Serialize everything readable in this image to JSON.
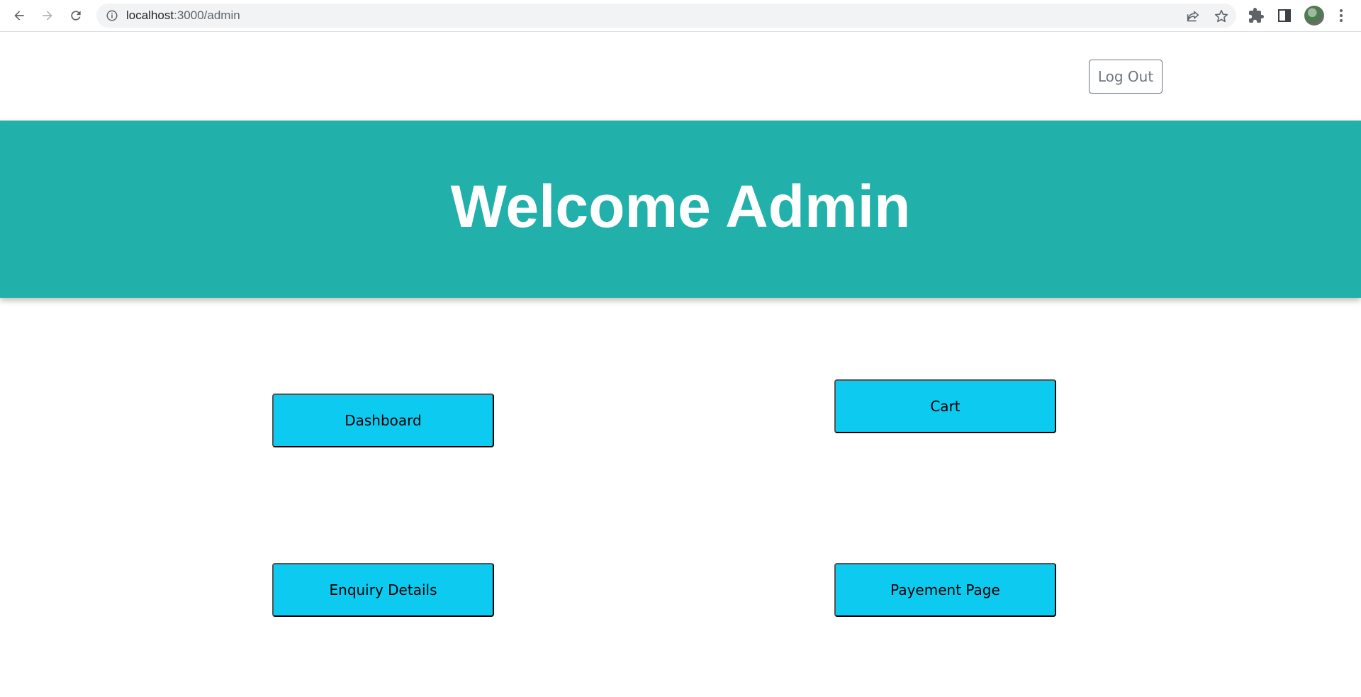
{
  "browser": {
    "url_host": "localhost",
    "url_path": ":3000/admin"
  },
  "header": {
    "logout_label": "Log Out"
  },
  "hero": {
    "title": "Welcome Admin"
  },
  "tiles": {
    "dashboard": "Dashboard",
    "cart": "Cart",
    "enquiry": "Enquiry Details",
    "payment": "Payement Page"
  },
  "colors": {
    "hero_bg": "#22b0aa",
    "tile_bg": "#0dcaf0",
    "logout_border": "#6c757d"
  },
  "icons": [
    "back-arrow-icon",
    "forward-arrow-icon",
    "reload-icon",
    "info-icon",
    "share-icon",
    "star-icon",
    "extensions-icon",
    "side-panel-icon",
    "menu-dots-icon"
  ]
}
